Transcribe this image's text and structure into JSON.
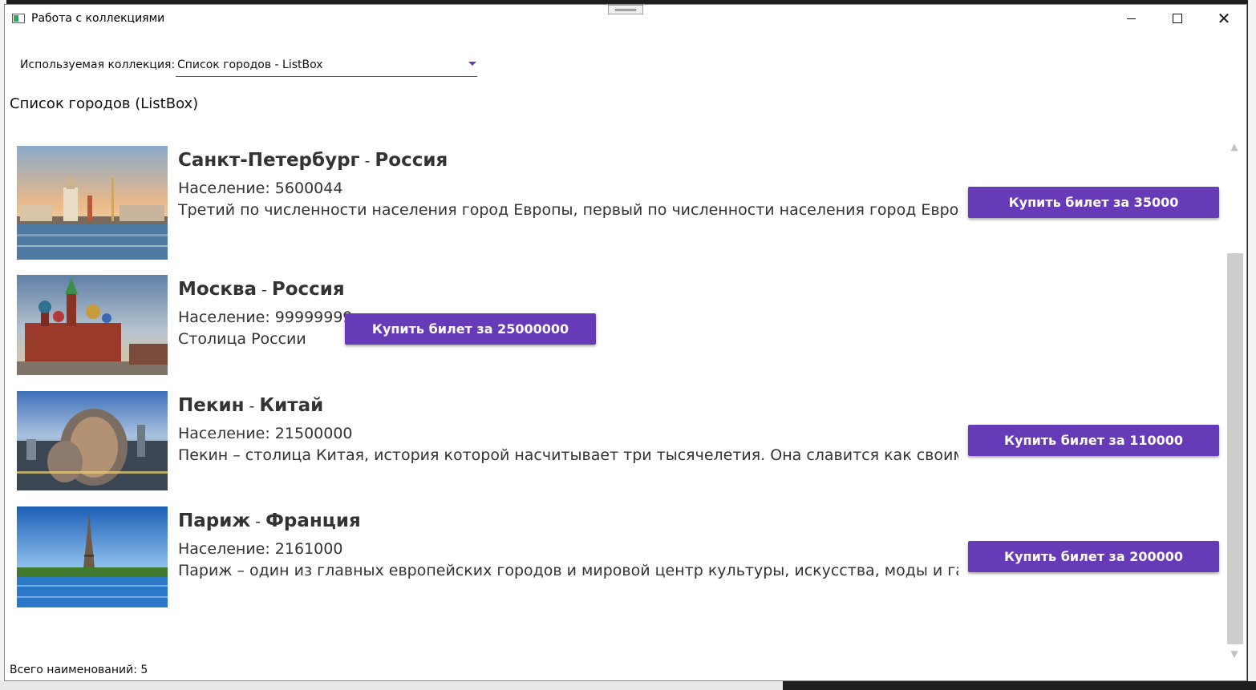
{
  "window": {
    "title": "Работа с коллекциями",
    "minimize_icon": "minimize-icon",
    "maximize_icon": "maximize-icon",
    "close_icon": "close-icon",
    "close_glyph": "✕"
  },
  "collection_selector": {
    "label": "Используемая коллекция:",
    "selected": "Список городов - ListBox"
  },
  "section_title": "Список городов (ListBox)",
  "cities": [
    {
      "name": "Санкт-Петербург",
      "separator": "-",
      "country": "Россия",
      "population": "Население: 5600044",
      "description": "Третий по численности населения город Европы, первый по численности населения город Европы, не яв",
      "button_label": "Купить билет за 35000",
      "image_icon": "saint-petersburg-photo"
    },
    {
      "name": "Москва",
      "separator": "-",
      "country": "Россия",
      "population": "Население: 99999999",
      "description": "Столица России",
      "button_label": "Купить билет за 25000000",
      "image_icon": "moscow-photo"
    },
    {
      "name": "Пекин",
      "separator": "-",
      "country": "Китай",
      "population": "Население: 21500000",
      "description": "Пекин – столица Китая, история которой насчитывает три тысячелетия. Она славится как своими совреме",
      "button_label": "Купить билет за 110000",
      "image_icon": "beijing-photo"
    },
    {
      "name": "Париж",
      "separator": "-",
      "country": "Франция",
      "population": "Население: 2161000",
      "description": "Париж – один из главных европейских городов и мировой центр культуры, искусства, моды и гастроном",
      "button_label": "Купить билет за 200000",
      "image_icon": "paris-photo"
    }
  ],
  "footer": {
    "total": "Всего наименований: 5"
  },
  "colors": {
    "accent": "#673ab7",
    "text": "#333333"
  }
}
